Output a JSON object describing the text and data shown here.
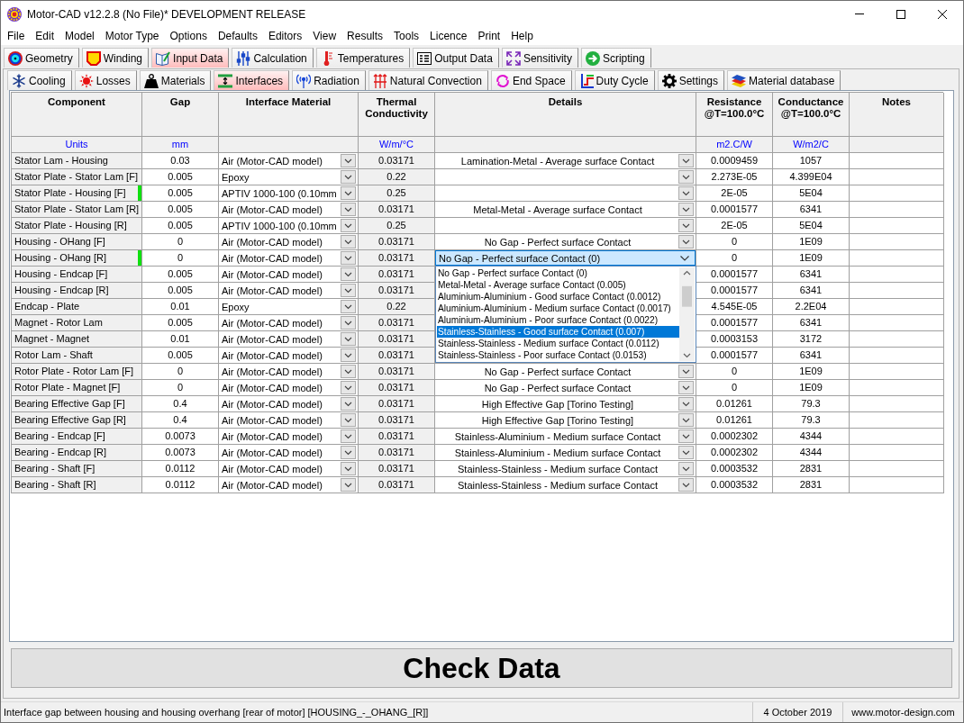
{
  "window": {
    "title": "Motor-CAD v12.2.8 (No File)* DEVELOPMENT RELEASE"
  },
  "menu": [
    "File",
    "Edit",
    "Model",
    "Motor Type",
    "Options",
    "Defaults",
    "Editors",
    "View",
    "Results",
    "Tools",
    "Licence",
    "Print",
    "Help"
  ],
  "main_tabs": [
    {
      "label": "Geometry",
      "selected": false
    },
    {
      "label": "Winding",
      "selected": false
    },
    {
      "label": "Input Data",
      "selected": true
    },
    {
      "label": "Calculation",
      "selected": false
    },
    {
      "label": "Temperatures",
      "selected": false
    },
    {
      "label": "Output Data",
      "selected": false
    },
    {
      "label": "Sensitivity",
      "selected": false
    },
    {
      "label": "Scripting",
      "selected": false
    }
  ],
  "sub_tabs": [
    {
      "label": "Cooling",
      "selected": false
    },
    {
      "label": "Losses",
      "selected": false
    },
    {
      "label": "Materials",
      "selected": false
    },
    {
      "label": "Interfaces",
      "selected": true
    },
    {
      "label": "Radiation",
      "selected": false
    },
    {
      "label": "Natural Convection",
      "selected": false
    },
    {
      "label": "End Space",
      "selected": false
    },
    {
      "label": "Duty Cycle",
      "selected": false
    },
    {
      "label": "Settings",
      "selected": false
    },
    {
      "label": "Material database",
      "selected": false
    }
  ],
  "table": {
    "columns": [
      "Component",
      "Gap",
      "Interface Material",
      "Thermal Conductivity",
      "Details",
      "Resistance @T=100.0°C",
      "Conductance @T=100.0°C",
      "Notes"
    ],
    "units": {
      "component": "Units",
      "gap": "mm",
      "conductivity": "W/m/°C",
      "resistance": "m2.C/W",
      "conductance": "W/m2/C"
    },
    "rows": [
      {
        "component": "Stator Lam - Housing",
        "flagged": false,
        "gap": "0.03",
        "material": "Air (Motor-CAD model)",
        "conductivity": "0.03171",
        "details": "Lamination-Metal - Average surface Contact",
        "editing": false,
        "resistance": "0.0009459",
        "conductance": "1057"
      },
      {
        "component": "Stator Plate - Stator Lam [F]",
        "flagged": false,
        "gap": "0.005",
        "material": "Epoxy",
        "conductivity": "0.22",
        "editing": false,
        "resistance": "2.273E-05",
        "conductance": "4.399E04"
      },
      {
        "component": "Stator Plate - Housing [F]",
        "flagged": true,
        "gap": "0.005",
        "material": "APTIV 1000-100 (0.10mm",
        "conductivity": "0.25",
        "editing": false,
        "resistance": "2E-05",
        "conductance": "5E04"
      },
      {
        "component": "Stator Plate - Stator Lam [R]",
        "flagged": false,
        "gap": "0.005",
        "material": "Air (Motor-CAD model)",
        "conductivity": "0.03171",
        "details": "Metal-Metal - Average surface Contact",
        "editing": false,
        "resistance": "0.0001577",
        "conductance": "6341"
      },
      {
        "component": "Stator Plate - Housing [R]",
        "flagged": false,
        "gap": "0.005",
        "material": "APTIV 1000-100 (0.10mm",
        "conductivity": "0.25",
        "editing": false,
        "resistance": "2E-05",
        "conductance": "5E04"
      },
      {
        "component": "Housing - OHang [F]",
        "flagged": false,
        "gap": "0",
        "material": "Air (Motor-CAD model)",
        "conductivity": "0.03171",
        "details": "No Gap - Perfect surface Contact",
        "editing": false,
        "resistance": "0",
        "conductance": "1E09"
      },
      {
        "component": "Housing - OHang [R]",
        "flagged": true,
        "gap": "0",
        "material": "Air (Motor-CAD model)",
        "conductivity": "0.03171",
        "details": "No Gap - Perfect surface Contact (0)",
        "editing": true,
        "resistance": "0",
        "conductance": "1E09"
      },
      {
        "component": "Housing - Endcap [F]",
        "flagged": false,
        "gap": "0.005",
        "material": "Air (Motor-CAD model)",
        "conductivity": "0.03171",
        "editing": false,
        "resistance": "0.0001577",
        "conductance": "6341"
      },
      {
        "component": "Housing - Endcap [R]",
        "flagged": false,
        "gap": "0.005",
        "material": "Air (Motor-CAD model)",
        "conductivity": "0.03171",
        "editing": false,
        "resistance": "0.0001577",
        "conductance": "6341"
      },
      {
        "component": "Endcap - Plate",
        "flagged": false,
        "gap": "0.01",
        "material": "Epoxy",
        "conductivity": "0.22",
        "editing": false,
        "resistance": "4.545E-05",
        "conductance": "2.2E04"
      },
      {
        "component": "Magnet - Rotor Lam",
        "flagged": false,
        "gap": "0.005",
        "material": "Air (Motor-CAD model)",
        "conductivity": "0.03171",
        "editing": false,
        "resistance": "0.0001577",
        "conductance": "6341"
      },
      {
        "component": "Magnet - Magnet",
        "flagged": false,
        "gap": "0.01",
        "material": "Air (Motor-CAD model)",
        "conductivity": "0.03171",
        "editing": false,
        "resistance": "0.0003153",
        "conductance": "3172"
      },
      {
        "component": "Rotor Lam - Shaft",
        "flagged": false,
        "gap": "0.005",
        "material": "Air (Motor-CAD model)",
        "conductivity": "0.03171",
        "editing": false,
        "resistance": "0.0001577",
        "conductance": "6341"
      },
      {
        "component": "Rotor Plate - Rotor Lam [F]",
        "flagged": false,
        "gap": "0",
        "material": "Air (Motor-CAD model)",
        "conductivity": "0.03171",
        "details": "No Gap - Perfect surface Contact",
        "editing": false,
        "resistance": "0",
        "conductance": "1E09"
      },
      {
        "component": "Rotor Plate - Magnet [F]",
        "flagged": false,
        "gap": "0",
        "material": "Air (Motor-CAD model)",
        "conductivity": "0.03171",
        "details": "No Gap - Perfect surface Contact",
        "editing": false,
        "resistance": "0",
        "conductance": "1E09"
      },
      {
        "component": "Bearing Effective Gap [F]",
        "flagged": false,
        "gap": "0.4",
        "material": "Air (Motor-CAD model)",
        "conductivity": "0.03171",
        "details": "High Effective Gap [Torino Testing]",
        "editing": false,
        "resistance": "0.01261",
        "conductance": "79.3"
      },
      {
        "component": "Bearing Effective Gap [R]",
        "flagged": false,
        "gap": "0.4",
        "material": "Air (Motor-CAD model)",
        "conductivity": "0.03171",
        "details": "High Effective Gap [Torino Testing]",
        "editing": false,
        "resistance": "0.01261",
        "conductance": "79.3"
      },
      {
        "component": "Bearing - Endcap [F]",
        "flagged": false,
        "gap": "0.0073",
        "material": "Air (Motor-CAD model)",
        "conductivity": "0.03171",
        "details": "Stainless-Aluminium - Medium surface Contact",
        "editing": false,
        "resistance": "0.0002302",
        "conductance": "4344"
      },
      {
        "component": "Bearing - Endcap [R]",
        "flagged": false,
        "gap": "0.0073",
        "material": "Air (Motor-CAD model)",
        "conductivity": "0.03171",
        "details": "Stainless-Aluminium - Medium surface Contact",
        "editing": false,
        "resistance": "0.0002302",
        "conductance": "4344"
      },
      {
        "component": "Bearing - Shaft [F]",
        "flagged": false,
        "gap": "0.0112",
        "material": "Air (Motor-CAD model)",
        "conductivity": "0.03171",
        "details": "Stainless-Stainless - Medium surface Contact",
        "editing": false,
        "resistance": "0.0003532",
        "conductance": "2831"
      },
      {
        "component": "Bearing - Shaft [R]",
        "flagged": false,
        "gap": "0.0112",
        "material": "Air (Motor-CAD model)",
        "conductivity": "0.03171",
        "details": "Stainless-Stainless - Medium surface Contact",
        "editing": false,
        "resistance": "0.0003532",
        "conductance": "2831"
      }
    ],
    "details_dropdown": {
      "options": [
        {
          "label": "No Gap - Perfect surface Contact (0)",
          "selected": false
        },
        {
          "label": "Metal-Metal - Average surface Contact (0.005)",
          "selected": false
        },
        {
          "label": "Aluminium-Aluminium - Good surface Contact (0.0012)",
          "selected": false
        },
        {
          "label": "Aluminium-Aluminium - Medium surface Contact (0.0017)",
          "selected": false
        },
        {
          "label": "Aluminium-Aluminium - Poor surface Contact (0.0022)",
          "selected": false
        },
        {
          "label": "Stainless-Stainless - Good surface Contact (0.007)",
          "selected": true
        },
        {
          "label": "Stainless-Stainless - Medium surface Contact (0.0112)",
          "selected": false
        },
        {
          "label": "Stainless-Stainless - Poor surface Contact (0.0153)",
          "selected": false
        }
      ]
    }
  },
  "check_button": "Check Data",
  "status_bar": {
    "message": "Interface gap between housing and housing overhang [rear of motor] [HOUSING_-_OHANG_[R]]",
    "date": "4 October 2019",
    "website": "www.motor-design.com"
  }
}
